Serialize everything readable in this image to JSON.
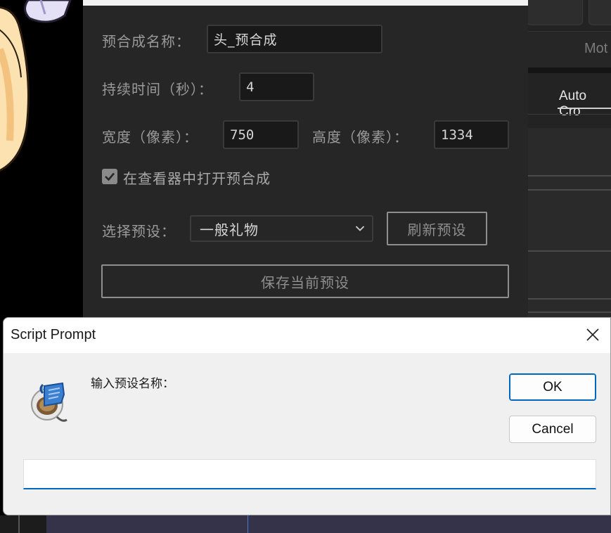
{
  "background_panel": {
    "precomp_name_label": "预合成名称：",
    "precomp_name_value": "头_预合成",
    "duration_label": "持续时间（秒）：",
    "duration_value": "4",
    "width_label": "宽度（像素）：",
    "width_value": "750",
    "height_label": "高度（像素）：",
    "height_value": "1334",
    "open_in_viewer_label": "在查看器中打开预合成",
    "open_in_viewer_checked": true,
    "preset_label": "选择预设：",
    "preset_selected": "一般礼物",
    "refresh_button": "刷新预设",
    "save_button": "保存当前预设"
  },
  "right_panel": {
    "partial_label": "Mot",
    "active_tab": "Auto Cro"
  },
  "dialog": {
    "title": "Script Prompt",
    "prompt": "输入预设名称：",
    "ok_label": "OK",
    "cancel_label": "Cancel",
    "input_value": ""
  },
  "colors": {
    "accent": "#0067c0",
    "panel_bg": "#262626",
    "dialog_bg": "#f0f0f0"
  }
}
